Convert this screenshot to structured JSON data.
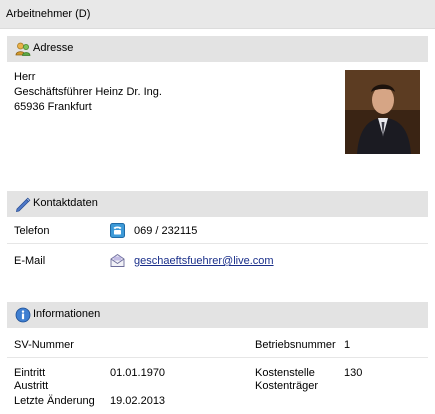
{
  "window": {
    "title": "Arbeitnehmer (D)"
  },
  "address": {
    "header": "Adresse",
    "lines": [
      "Herr",
      "Geschäftsführer Heinz Dr. Ing.",
      "65936 Frankfurt"
    ]
  },
  "contact": {
    "header": "Kontaktdaten",
    "phone_label": "Telefon",
    "phone_value": "069 / 232115",
    "email_label": "E-Mail",
    "email_value": "geschaeftsfuehrer@live.com"
  },
  "info": {
    "header": "Informationen",
    "sv_label": "SV-Nummer",
    "sv_value": "",
    "betrieb_label": "Betriebsnummer",
    "betrieb_value": "1",
    "eintritt_label": "Eintritt",
    "eintritt_value": "01.01.1970",
    "austritt_label": "Austritt",
    "austritt_value": "",
    "aenderung_label": "Letzte Änderung",
    "aenderung_value": "19.02.2013",
    "kostenstelle_label": "Kostenstelle",
    "kostenstelle_value": "130",
    "kostentraeger_label": "Kostenträger",
    "kostentraeger_value": ""
  },
  "icons": {
    "address": "people-icon",
    "contact": "pencil-icon",
    "info": "info-icon",
    "phone": "phone-icon",
    "email": "envelope-icon"
  },
  "colors": {
    "header_bg": "#e3e3e3",
    "link": "#1a2f8a"
  }
}
